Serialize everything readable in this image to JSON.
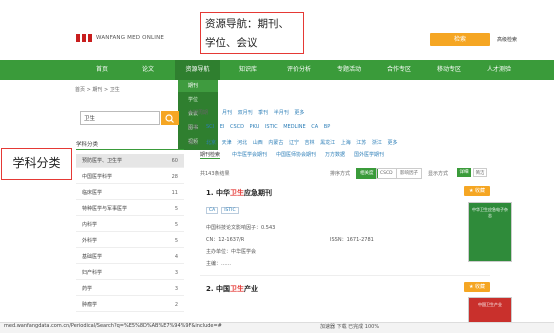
{
  "header": {
    "logo_text": "WANFANG MED ONLINE",
    "search_button": "检索",
    "advanced_search": "高级检索"
  },
  "nav": {
    "items": [
      "首页",
      "论文",
      "资源导航",
      "知识库",
      "评价分析",
      "专题活动",
      "合作专区",
      "移动专区",
      "人才测验"
    ]
  },
  "callouts": {
    "top": "资源导航：期刊、学位、会议",
    "left": "学科分类"
  },
  "dropdown": {
    "items": [
      "期刊",
      "学位",
      "会议",
      "图书",
      "视频"
    ],
    "active": "期刊"
  },
  "breadcrumb": "首页 > 期刊 > 卫生",
  "sidebar": {
    "search_value": "卫生",
    "title": "学科分类",
    "categories": [
      {
        "name": "预防医学、卫生学",
        "count": "60"
      },
      {
        "name": "中国医学科学",
        "count": "28"
      },
      {
        "name": "临床医学",
        "count": "11"
      },
      {
        "name": "特种医学与军事医学",
        "count": "5"
      },
      {
        "name": "内科学",
        "count": "5"
      },
      {
        "name": "外科学",
        "count": "5"
      },
      {
        "name": "基础医学",
        "count": "4"
      },
      {
        "name": "妇产科学",
        "count": "3"
      },
      {
        "name": "药学",
        "count": "3"
      },
      {
        "name": "肿瘤学",
        "count": "2"
      }
    ]
  },
  "filters": {
    "rows": [
      {
        "label": "出版周期",
        "options": "月刊 双月刊 季刊 半月刊 更多"
      },
      {
        "label": "收录",
        "options": "SCI EI CSCD PKU ISTIC MEDLINE CA BP"
      },
      {
        "label": "地区",
        "options": "北京 天津 河北 山西 内蒙古 辽宁 吉林 黑龙江 上海 江苏 浙江 更多"
      }
    ],
    "tabs": [
      "期刊检索",
      "中华医学会期刊",
      "中国医师协会期刊",
      "万方数据",
      "国外医学期刊"
    ]
  },
  "results": {
    "count_text": "共143条结果",
    "sort_label": "排序方式",
    "sort_options": [
      "相关度",
      "CSCD",
      "影响因子"
    ],
    "display_label": "显示方式",
    "view_options": [
      "详细",
      "简洁"
    ],
    "favorite_label": "收藏",
    "items": [
      {
        "index": "1.",
        "title_prefix": "中华",
        "title_highlight": "卫生",
        "title_suffix": "应急期刊",
        "tags": [
          "CA",
          "ISTIC"
        ],
        "meta": [
          "中国科技论文影响因子：0.543",
          "CN：12-1637/R",
          "ISSN：1671-2781",
          "主办单位：中华医学会",
          "主编：……"
        ],
        "cover_title": "中华卫生应急电子杂志"
      },
      {
        "index": "2.",
        "title_prefix": "中国",
        "title_highlight": "卫生",
        "title_suffix": "产业",
        "cover_title": "中国卫生产业"
      }
    ]
  },
  "statusbar": {
    "url": "med.wanfangdata.com.cn/Periodical/Search?q=%E5%8D%AB%E7%94%9F&include=#",
    "right": "加速器 下载 已完成 100%"
  },
  "colors": {
    "nav_green": "#3a9b3a",
    "accent_orange": "#f5a623",
    "highlight_red": "#e53935",
    "link_blue": "#2e7fb8"
  }
}
